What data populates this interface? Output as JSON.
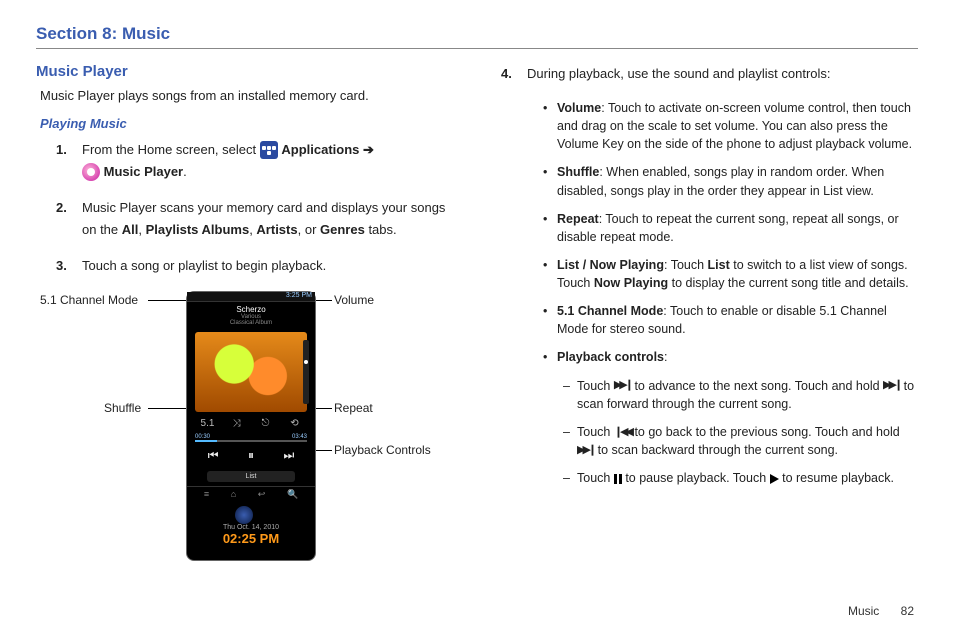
{
  "section_title": "Section 8: Music",
  "left": {
    "heading": "Music Player",
    "intro": "Music Player plays songs from an installed memory card.",
    "subheading": "Playing Music",
    "steps": {
      "s1_a": "From the Home screen, select ",
      "s1_apps": "Applications",
      "s1_arrow": "➔",
      "s1_mp": "Music Player",
      "s2_a": "Music Player scans your memory card and displays your songs on the ",
      "s2_all": "All",
      "s2_pa": "Playlists Albums",
      "s2_ar": "Artists",
      "s2_or": ", or ",
      "s2_ge": "Genres",
      "s2_end": " tabs.",
      "s3": "Touch a song or playlist to begin playback."
    },
    "labels": {
      "ch51": "5.1 Channel Mode",
      "volume": "Volume",
      "shuffle": "Shuffle",
      "repeat": "Repeat",
      "playback": "Playback Controls"
    },
    "phone": {
      "status_time": "3:25 PM",
      "track_title": "Scherzo",
      "track_sub1": "Various",
      "track_sub2": "Classical Album",
      "time_cur": "00:30",
      "time_tot": "03:43",
      "list": "List",
      "date": "Thu Oct. 14, 2010",
      "clock": "02:25 PM"
    }
  },
  "right": {
    "step4": "During playback, use the sound and playlist controls:",
    "bullets": {
      "volume": {
        "term": "Volume",
        "text": ": Touch to activate on-screen volume control, then touch and drag on the scale to set volume. You can also press the Volume Key on the side of the phone to adjust playback volume."
      },
      "shuffle": {
        "term": "Shuffle",
        "text": ": When enabled, songs play in random order. When disabled, songs play in the order they appear in List view."
      },
      "repeat": {
        "term": "Repeat",
        "text": ": Touch to repeat the current song, repeat all songs, or disable repeat mode."
      },
      "listnp": {
        "term": "List / Now Playing",
        "a": ": Touch ",
        "b": "List",
        "c": " to switch to a list view of songs. Touch ",
        "d": "Now Playing",
        "e": " to display the current song title and details."
      },
      "ch51": {
        "term": "5.1 Channel Mode",
        "text": ": Touch to enable or disable 5.1 Channel Mode for stereo sound."
      },
      "pbc": {
        "term": "Playback controls",
        "text": ":"
      }
    },
    "subs": {
      "s1a": "Touch ",
      "s1b": " to advance to the next song. Touch and hold ",
      "s1c": " to scan forward through the current song.",
      "s2a": "Touch ",
      "s2b": " to go back to the previous song. Touch and hold ",
      "s2c": " to scan backward through the current song.",
      "s3a": "Touch ",
      "s3b": " to pause playback. Touch ",
      "s3c": " to resume playback."
    }
  },
  "footer": {
    "label": "Music",
    "page": "82"
  }
}
